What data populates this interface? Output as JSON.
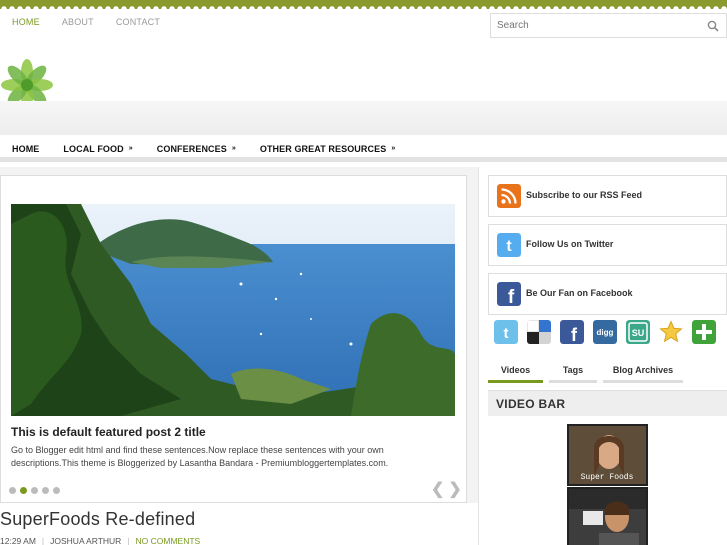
{
  "top_nav": [
    "HOME",
    "ABOUT",
    "CONTACT"
  ],
  "search": {
    "placeholder": "Search"
  },
  "main_nav": [
    {
      "label": "HOME",
      "has_submenu": false
    },
    {
      "label": "LOCAL FOOD",
      "has_submenu": true
    },
    {
      "label": "CONFERENCES",
      "has_submenu": true
    },
    {
      "label": "OTHER GREAT RESOURCES",
      "has_submenu": true
    }
  ],
  "submenu_glyph": "»",
  "featured": {
    "title": "This is default featured post 2 title",
    "description": "Go to Blogger edit html and find these sentences.Now replace these sentences with your own descriptions.This theme is Bloggerized by Lasantha Bandara - Premiumbloggertemplates.com.",
    "dot_count": 5,
    "active_dot": 1,
    "prev_glyph": "❮",
    "next_glyph": "❯"
  },
  "post": {
    "title": "SuperFoods Re-defined",
    "time": "12:29 AM",
    "author": "JOSHUA ARTHUR",
    "comments": "NO COMMENTS",
    "separator": "|"
  },
  "sidebar": {
    "feeds": [
      {
        "label": "Subscribe to our RSS Feed",
        "icon": "rss-icon",
        "color": "#e8731a"
      },
      {
        "label": "Follow Us on Twitter",
        "icon": "twitter-icon",
        "color": "#55acee"
      },
      {
        "label": "Be Our Fan on Facebook",
        "icon": "facebook-icon",
        "color": "#3b5998"
      }
    ],
    "social_icons": [
      "twitter-icon",
      "delicious-icon",
      "facebook-icon",
      "digg-icon",
      "stumbleupon-icon",
      "favorite-star-icon",
      "add-plus-icon"
    ],
    "tabs": [
      "Videos",
      "Tags",
      "Blog Archives"
    ],
    "active_tab": 0,
    "video_bar_title": "VIDEO BAR",
    "video_thumb_caption": "Super Foods"
  },
  "colors": {
    "accent": "#7a9a1f",
    "stripe": "#8a9a2c"
  }
}
